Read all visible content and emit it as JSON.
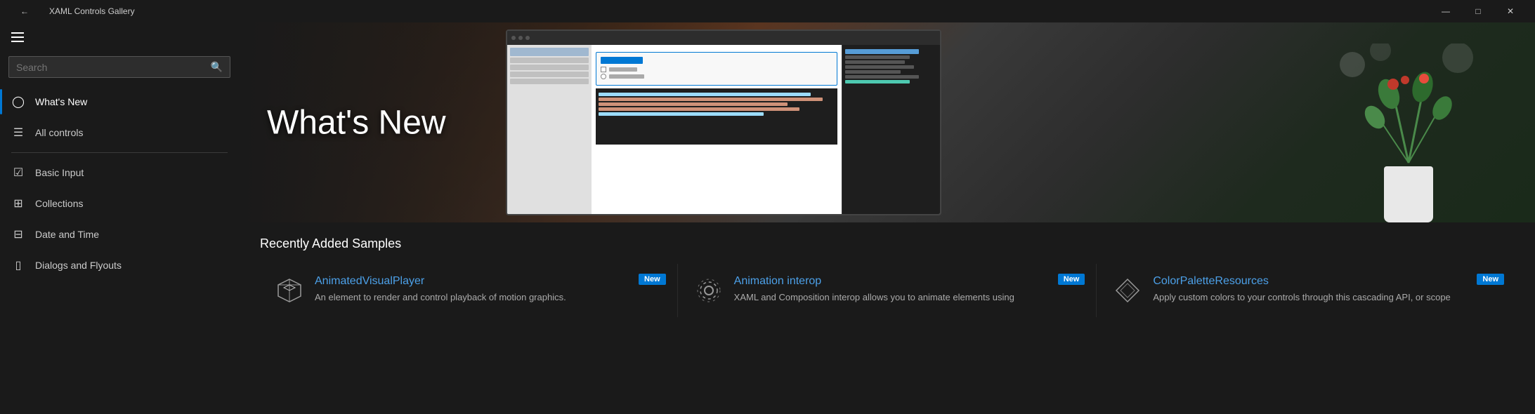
{
  "titlebar": {
    "title": "XAML Controls Gallery",
    "back_icon": "←",
    "minimize_label": "—",
    "maximize_label": "□",
    "close_label": "✕"
  },
  "sidebar": {
    "hamburger_label": "Menu",
    "search": {
      "placeholder": "Search",
      "icon": "🔍"
    },
    "nav_items": [
      {
        "id": "whats-new",
        "label": "What's New",
        "icon": "⊙",
        "active": true
      },
      {
        "id": "all-controls",
        "label": "All controls",
        "icon": "☰",
        "active": false
      }
    ],
    "nav_items_secondary": [
      {
        "id": "basic-input",
        "label": "Basic Input",
        "icon": "☑",
        "active": false
      },
      {
        "id": "collections",
        "label": "Collections",
        "icon": "⊞",
        "active": false
      },
      {
        "id": "date-and-time",
        "label": "Date and Time",
        "icon": "⊟",
        "active": false
      },
      {
        "id": "dialogs-and-flyouts",
        "label": "Dialogs and Flyouts",
        "icon": "◫",
        "active": false
      }
    ]
  },
  "hero": {
    "title": "What's New"
  },
  "recently_added": {
    "section_title": "Recently Added Samples",
    "cards": [
      {
        "id": "animated-visual-player",
        "title": "AnimatedVisualPlayer",
        "description": "An element to render and control playback of motion graphics.",
        "badge": "New",
        "icon": "📦"
      },
      {
        "id": "animation-interop",
        "title": "Animation interop",
        "description": "XAML and Composition interop allows you to animate elements using",
        "badge": "New",
        "icon": "⚙"
      },
      {
        "id": "color-palette-resources",
        "title": "ColorPaletteResources",
        "description": "Apply custom colors to your controls through this cascading API, or scope",
        "badge": "New",
        "icon": "◇"
      }
    ]
  }
}
